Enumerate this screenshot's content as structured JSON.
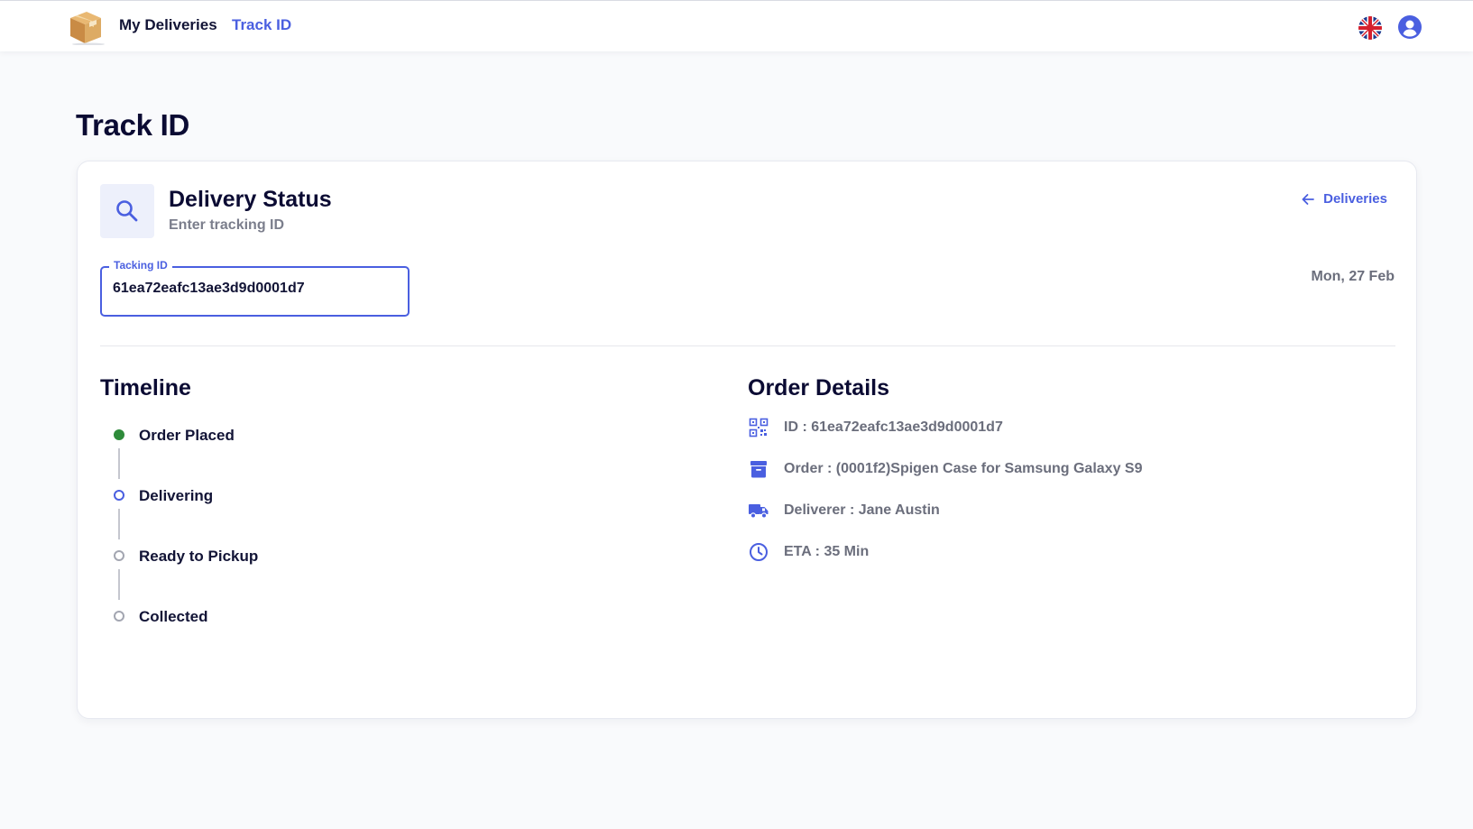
{
  "nav": {
    "my_deliveries": "My Deliveries",
    "track_id": "Track ID",
    "language_icon": "uk-flag-icon",
    "account_icon": "user-circle-icon"
  },
  "page": {
    "title": "Track ID"
  },
  "card": {
    "title": "Delivery Status",
    "subtitle": "Enter tracking ID",
    "back_label": "Deliveries",
    "date": "Mon, 27 Feb",
    "tracking_field": {
      "label": "Tacking ID",
      "value": "61ea72eafc13ae3d9d0001d7"
    }
  },
  "timeline": {
    "title": "Timeline",
    "steps": [
      {
        "label": "Order Placed",
        "state": "done"
      },
      {
        "label": "Delivering",
        "state": "current"
      },
      {
        "label": "Ready to Pickup",
        "state": "pending"
      },
      {
        "label": "Collected",
        "state": "pending"
      }
    ]
  },
  "details": {
    "title": "Order Details",
    "rows": [
      {
        "icon": "qr-code-icon",
        "text": "ID : 61ea72eafc13ae3d9d0001d7"
      },
      {
        "icon": "archive-box-icon",
        "text": "Order : (0001f2)Spigen Case for Samsung Galaxy S9"
      },
      {
        "icon": "truck-icon",
        "text": "Deliverer : Jane Austin"
      },
      {
        "icon": "clock-icon",
        "text": "ETA : 35 Min"
      }
    ]
  },
  "colors": {
    "accent": "#4a5fe0",
    "done": "#2e8b3a",
    "pending": "#a3a6b1",
    "heading": "#0b0b33"
  }
}
